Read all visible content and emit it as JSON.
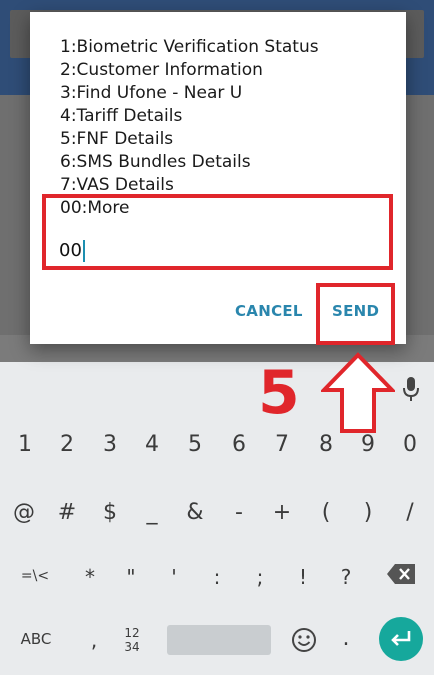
{
  "dialog": {
    "menu_items": [
      "1:Biometric Verification Status",
      "2:Customer Information",
      "3:Find Ufone - Near U",
      "4:Tariff Details",
      "5:FNF Details",
      "6:SMS Bundles Details",
      "7:VAS Details"
    ],
    "more_option": "00:More",
    "input_value": "00",
    "cancel_label": "CANCEL",
    "send_label": "SEND"
  },
  "annotation": {
    "step_number": "5",
    "color": "#e0262b"
  },
  "keyboard": {
    "row_numbers": [
      "1",
      "2",
      "3",
      "4",
      "5",
      "6",
      "7",
      "8",
      "9",
      "0"
    ],
    "row_symbols": [
      "@",
      "#",
      "$",
      "_",
      "&",
      "-",
      "+",
      "(",
      ")",
      "/"
    ],
    "row_more": [
      "=\\<",
      "*",
      "\"",
      "'",
      ":",
      ";",
      "!",
      "?"
    ],
    "abc_label": "ABC",
    "comma_label": ",",
    "numpad_label_top": "12",
    "numpad_label_bottom": "34",
    "period_label": ".",
    "accent_color": "#16a89c"
  }
}
